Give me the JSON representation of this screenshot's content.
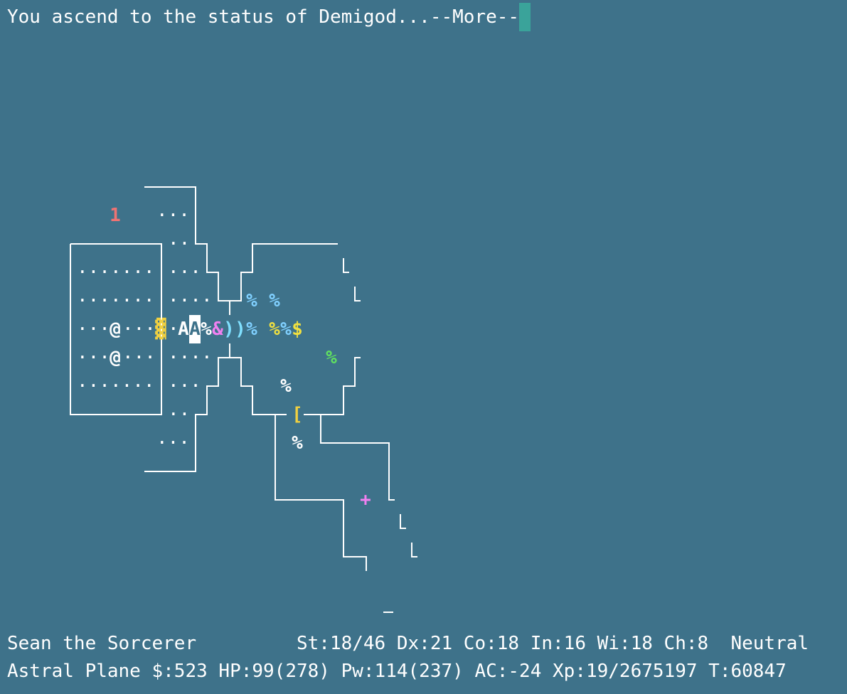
{
  "message": {
    "text": "You ascend to the status of Demigod...--More--"
  },
  "status": {
    "line1": "Sean the Sorcerer         St:18/46 Dx:21 Co:18 In:16 Wi:18 Ch:8  Neutral",
    "line2": "Astral Plane $:523 HP:99(278) Pw:114(237) AC:-24 Xp:19/2675197 T:60847"
  },
  "map": {
    "dot_rows": [
      {
        "id": "r1",
        "text": "···"
      },
      {
        "id": "r2",
        "text": "··"
      },
      {
        "id": "r3a",
        "text": "·······"
      },
      {
        "id": "r3b",
        "text": "···"
      },
      {
        "id": "r4a",
        "text": "·······"
      },
      {
        "id": "r4b",
        "text": "····"
      },
      {
        "id": "r5a",
        "text": "···"
      },
      {
        "id": "r5b",
        "text": "···"
      },
      {
        "id": "r5c",
        "text": "·"
      },
      {
        "id": "r6a",
        "text": "···"
      },
      {
        "id": "r6b",
        "text": "···"
      },
      {
        "id": "r6c",
        "text": "····"
      },
      {
        "id": "r7a",
        "text": "·······"
      },
      {
        "id": "r7b",
        "text": "···"
      },
      {
        "id": "r8",
        "text": "··"
      },
      {
        "id": "r9",
        "text": "···"
      }
    ],
    "glyphs": [
      {
        "id": "number-1",
        "char": "1",
        "color": "#ee7373"
      },
      {
        "id": "player-at",
        "char": "@",
        "color": "#ffffff"
      },
      {
        "id": "ally-at",
        "char": "@",
        "color": "#ffffff"
      },
      {
        "id": "yellow-square",
        "char": "▓",
        "color": "#f0d040"
      },
      {
        "id": "angel-a1",
        "char": "A",
        "color": "#ffffff"
      },
      {
        "id": "angel-a2",
        "char": "A",
        "color": "#ffffff"
      },
      {
        "id": "food-1",
        "char": "%",
        "color": "#ffffff"
      },
      {
        "id": "demon",
        "char": "&",
        "color": "#f080f0"
      },
      {
        "id": "weapon-1",
        "char": ")",
        "color": "#80e0ff"
      },
      {
        "id": "weapon-2",
        "char": ")",
        "color": "#80e0ff"
      },
      {
        "id": "food-2",
        "char": "%",
        "color": "#80d0ff"
      },
      {
        "id": "food-3",
        "char": "%",
        "color": "#f0e040"
      },
      {
        "id": "food-4",
        "char": "%",
        "color": "#80d0ff"
      },
      {
        "id": "gold",
        "char": "$",
        "color": "#f0e040"
      },
      {
        "id": "food-5",
        "char": "%",
        "color": "#80d0ff"
      },
      {
        "id": "food-6",
        "char": "%",
        "color": "#80d0ff"
      },
      {
        "id": "food-green",
        "char": "%",
        "color": "#60e060"
      },
      {
        "id": "food-white-1",
        "char": "%",
        "color": "#ffffff"
      },
      {
        "id": "armor",
        "char": "[",
        "color": "#f0d040"
      },
      {
        "id": "food-white-2",
        "char": "%",
        "color": "#ffffff"
      },
      {
        "id": "spellbook",
        "char": "+",
        "color": "#f080f0"
      }
    ],
    "wall_color": "#ffffff"
  }
}
